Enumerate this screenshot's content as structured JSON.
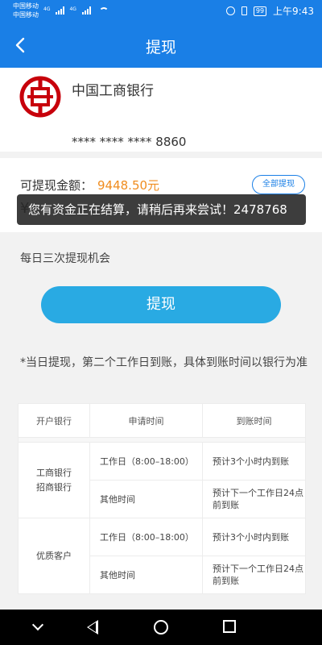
{
  "status_bar": {
    "carrier_1": "中国移动",
    "carrier_2": "中国移动",
    "net_1": "4G",
    "net_2": "4G",
    "battery": "99",
    "time": "上午9:43"
  },
  "header": {
    "title": "提现",
    "back_icon": "chevron-left-icon"
  },
  "bank": {
    "name": "中国工商银行",
    "card_number": "**** **** **** 8860",
    "logo_color": "#c7000b"
  },
  "amount": {
    "label": "可提现金额：",
    "value": "9448.50元",
    "withdraw_all_label": "全部提现",
    "currency_symbol": "¥"
  },
  "toast": {
    "message": "您有资金正在结算，请稍后再来尝试！2478768"
  },
  "chance_text": "每日三次提现机会",
  "withdraw_button": "提现",
  "note": "*当日提现，第二个工作日到账，具体到账时间以银行为准",
  "schedule_table": {
    "headers": [
      "开户银行",
      "申请时间",
      "到账时间"
    ],
    "groups": [
      {
        "bank_lines": [
          "工商银行",
          "招商银行"
        ],
        "rows": [
          {
            "apply": "工作日（8:00–18:00）",
            "arrive": "预计3个小时内到账"
          },
          {
            "apply": "其他时间",
            "arrive": "预计下一个工作日24点前到账"
          }
        ]
      },
      {
        "bank_lines": [
          "优质客户"
        ],
        "rows": [
          {
            "apply": "工作日（8:00–18:00）",
            "arrive": "预计3个小时内到账"
          },
          {
            "apply": "其他时间",
            "arrive": "预计下一个工作日24点前到账"
          }
        ]
      }
    ]
  },
  "colors": {
    "primary": "#1a7fe6",
    "button": "#29aae3",
    "amount": "#f08c1e"
  },
  "system_nav": {
    "icons": [
      "collapse-icon",
      "back-triangle-icon",
      "home-circle-icon",
      "recent-square-icon"
    ]
  }
}
